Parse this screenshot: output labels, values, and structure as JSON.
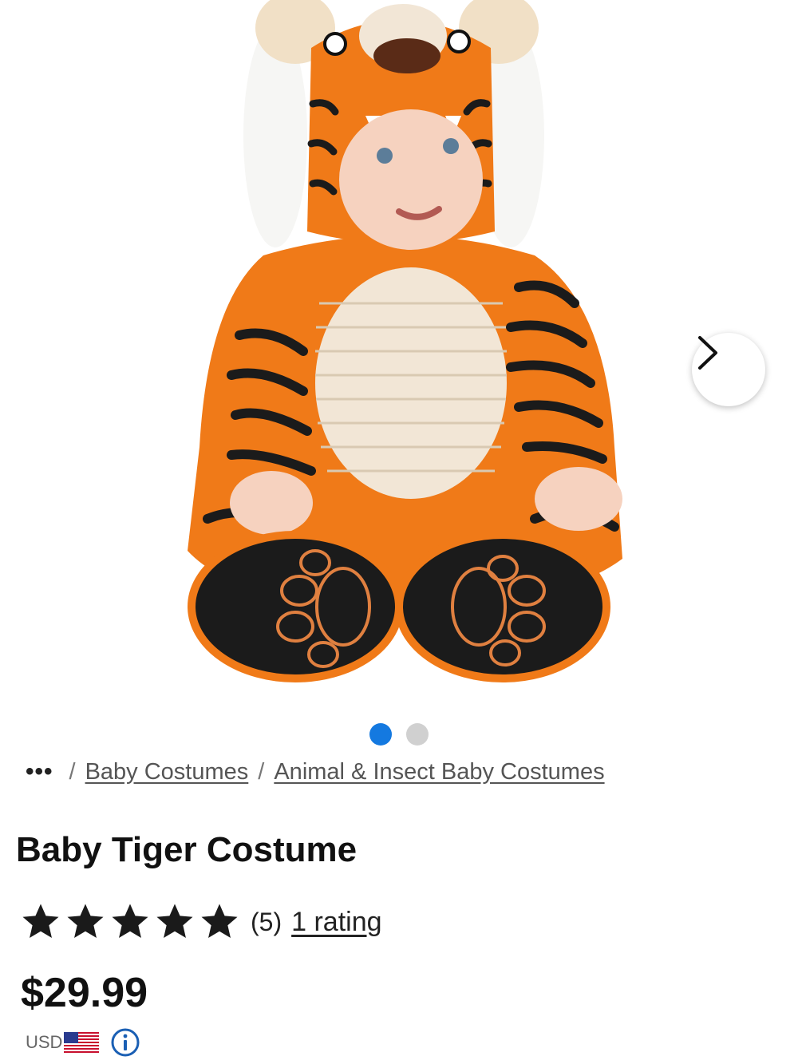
{
  "gallery": {
    "image_alt": "Baby Tiger Costume",
    "next_icon": "chevron-right-icon",
    "dots": [
      {
        "active": true
      },
      {
        "active": false
      }
    ],
    "accent": "#1479e0"
  },
  "breadcrumb": {
    "more": "•••",
    "separator": "/",
    "items": [
      "Baby Costumes",
      "Animal & Insect Baby Costumes"
    ]
  },
  "product": {
    "title": "Baby Tiger Costume",
    "rating": {
      "value": 5,
      "max": 5,
      "count_text": "(5)",
      "link_text": "1 rating"
    },
    "price": "$29.99",
    "currency": "USD",
    "currency_flag_icon": "us-flag-icon",
    "info_icon": "info-icon"
  }
}
